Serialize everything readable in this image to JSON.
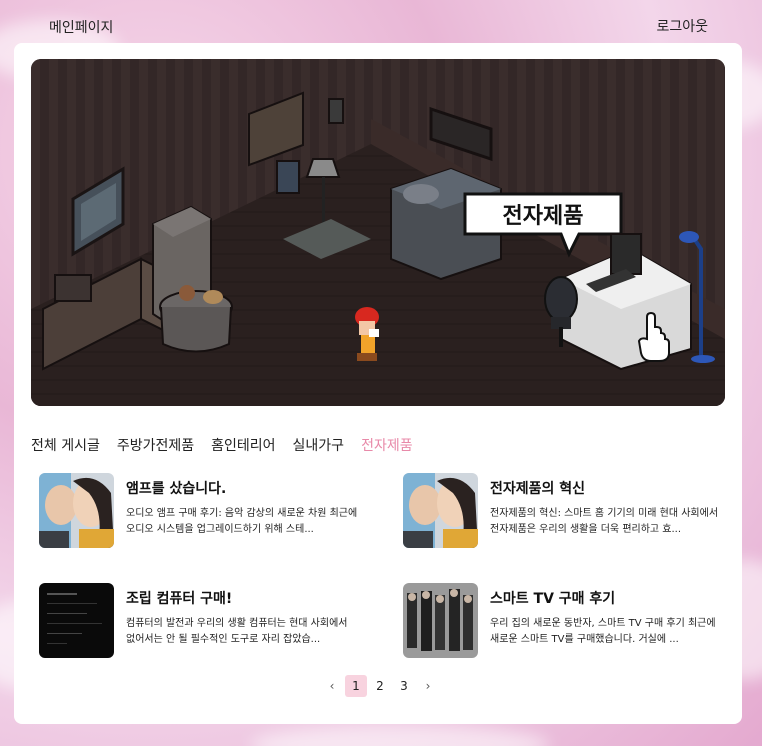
{
  "header": {
    "home_label": "메인페이지",
    "logout_label": "로그아웃"
  },
  "hero": {
    "bubble_text": "전자제품"
  },
  "tabs": [
    {
      "label": "전체 게시글"
    },
    {
      "label": "주방가전제품"
    },
    {
      "label": "홈인테리어"
    },
    {
      "label": "실내가구"
    },
    {
      "label": "전자제품"
    }
  ],
  "active_tab": "전자제품",
  "posts": [
    {
      "title": "앰프를 샀습니다.",
      "excerpt": "오디오 앰프 구매 후기: 음악 감상의 새로운 차원 최근에 오디오 시스템을 업그레이드하기 위해 스테..."
    },
    {
      "title": "전자제품의 혁신",
      "excerpt": "전자제품의 혁신: 스마트 홈 기기의 미래 현대 사회에서 전자제품은 우리의 생활을 더욱 편리하고 효..."
    },
    {
      "title": "조립 컴퓨터 구매!",
      "excerpt": "컴퓨터의 발전과 우리의 생활 컴퓨터는 현대 사회에서 없어서는 안 될 필수적인 도구로 자리 잡았습..."
    },
    {
      "title": "스마트 TV 구매 후기",
      "excerpt": "우리 집의 새로운 동반자, 스마트 TV 구매 후기 최근에 새로운 스마트 TV를 구매했습니다. 거실에 ..."
    }
  ],
  "pagination": {
    "prev": "‹",
    "pages": [
      "1",
      "2",
      "3"
    ],
    "current": "1",
    "next": "›"
  },
  "colors": {
    "accent": "#e88aa9",
    "active_page_bg": "#f8d3df"
  }
}
